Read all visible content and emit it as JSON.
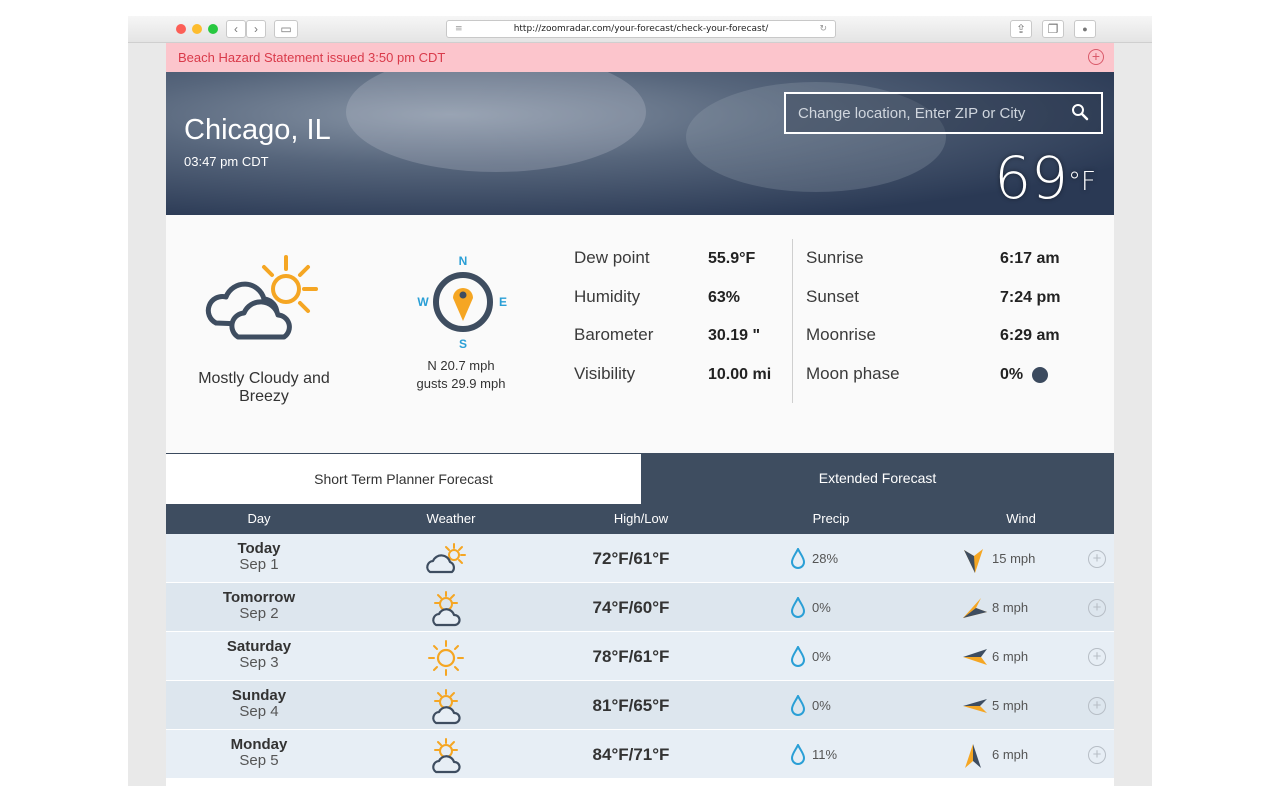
{
  "browser": {
    "url": "http://zoomradar.com/your-forecast/check-your-forecast/",
    "back_glyph": "‹",
    "forward_glyph": "›",
    "sidebar_glyph": "▭",
    "share_glyph": "⇪",
    "tabs_glyph": "❐",
    "download_glyph": "●",
    "menu_glyph": "≡",
    "reload_glyph": "↻"
  },
  "alert": {
    "text": "Beach Hazard Statement issued 3:50 pm CDT",
    "plus": "+"
  },
  "hero": {
    "city": "Chicago, IL",
    "time": "03:47 pm CDT",
    "search_placeholder": "Change location, Enter ZIP or City",
    "temperature": "69",
    "temperature_unit": "°F"
  },
  "current": {
    "condition": "Mostly Cloudy and Breezy",
    "wind_line1": "N 20.7 mph",
    "wind_line2": "gusts 29.9 mph",
    "compass": {
      "n": "N",
      "e": "E",
      "s": "S",
      "w": "W"
    },
    "stats_left": [
      {
        "label": "Dew point",
        "value": "55.9°F"
      },
      {
        "label": "Humidity",
        "value": "63%"
      },
      {
        "label": "Barometer",
        "value": "30.19 \""
      },
      {
        "label": "Visibility",
        "value": "10.00 mi"
      }
    ],
    "stats_right": [
      {
        "label": "Sunrise",
        "value": "6:17 am"
      },
      {
        "label": "Sunset",
        "value": "7:24 pm"
      },
      {
        "label": "Moonrise",
        "value": "6:29 am"
      },
      {
        "label": "Moon phase",
        "value": "0%"
      }
    ]
  },
  "tabs": {
    "short_term": "Short Term Planner Forecast",
    "extended": "Extended Forecast"
  },
  "table": {
    "headers": [
      "Day",
      "Weather",
      "High/Low",
      "Precip",
      "Wind"
    ],
    "rows": [
      {
        "day": "Today",
        "date": "Sep 1",
        "icon": "cloud-sun-icon",
        "highlow": "72°F/61°F",
        "precip": "28%",
        "wind": "15 mph"
      },
      {
        "day": "Tomorrow",
        "date": "Sep 2",
        "icon": "sun-cloud-icon",
        "highlow": "74°F/60°F",
        "precip": "0%",
        "wind": "8 mph"
      },
      {
        "day": "Saturday",
        "date": "Sep 3",
        "icon": "sun-icon",
        "highlow": "78°F/61°F",
        "precip": "0%",
        "wind": "6 mph"
      },
      {
        "day": "Sunday",
        "date": "Sep 4",
        "icon": "sun-cloud-icon",
        "highlow": "81°F/65°F",
        "precip": "0%",
        "wind": "5 mph"
      },
      {
        "day": "Monday",
        "date": "Sep 5",
        "icon": "sun-cloud-icon",
        "highlow": "84°F/71°F",
        "precip": "11%",
        "wind": "6 mph"
      }
    ],
    "row_plus": "+"
  },
  "colors": {
    "navy": "#3e4d60",
    "accent_orange": "#f5a623",
    "accent_blue": "#2a9fd6",
    "alert_bg": "#fcc5cc",
    "alert_text": "#d93a4a"
  }
}
